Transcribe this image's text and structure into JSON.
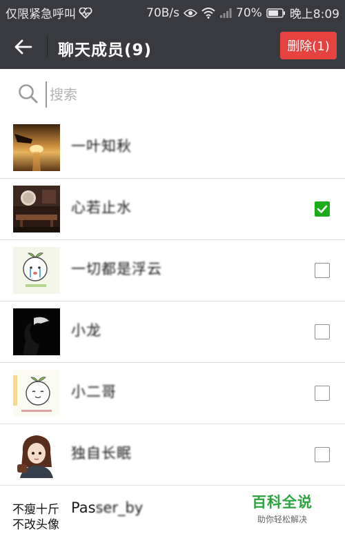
{
  "status_bar": {
    "carrier": "仅限紧急呼叫",
    "speed": "70B/s",
    "battery": "70%",
    "time": "晚上8:09"
  },
  "header": {
    "title": "聊天成员(9)",
    "delete_label": "删除(1)"
  },
  "search": {
    "placeholder": "搜索"
  },
  "members": [
    {
      "name": "一叶知秋",
      "checked": false,
      "has_checkbox": false,
      "avatar": "sunset-icon"
    },
    {
      "name": "心若止水",
      "checked": true,
      "has_checkbox": true,
      "avatar": "room-icon"
    },
    {
      "name": "一切都是浮云",
      "checked": false,
      "has_checkbox": true,
      "avatar": "sprout-cartoon-icon"
    },
    {
      "name": "小龙",
      "checked": false,
      "has_checkbox": true,
      "avatar": "dark-silhouette-icon"
    },
    {
      "name": "小二哥",
      "checked": false,
      "has_checkbox": true,
      "avatar": "sprout-cartoon-icon"
    },
    {
      "name": "独自长眠",
      "checked": false,
      "has_checkbox": true,
      "avatar": "girl-cartoon-icon"
    }
  ],
  "partial_member": {
    "avatar_text": "不瘦十斤不改头像",
    "name_visible": "Pas",
    "name_obscured": "ser_by"
  },
  "watermark": {
    "title": "百科全说",
    "subtitle": "助你轻松解决"
  },
  "colors": {
    "bar_bg": "#393a3f",
    "delete_red": "#e64340",
    "check_green": "#1aad19",
    "watermark_green": "#2ba33f"
  }
}
